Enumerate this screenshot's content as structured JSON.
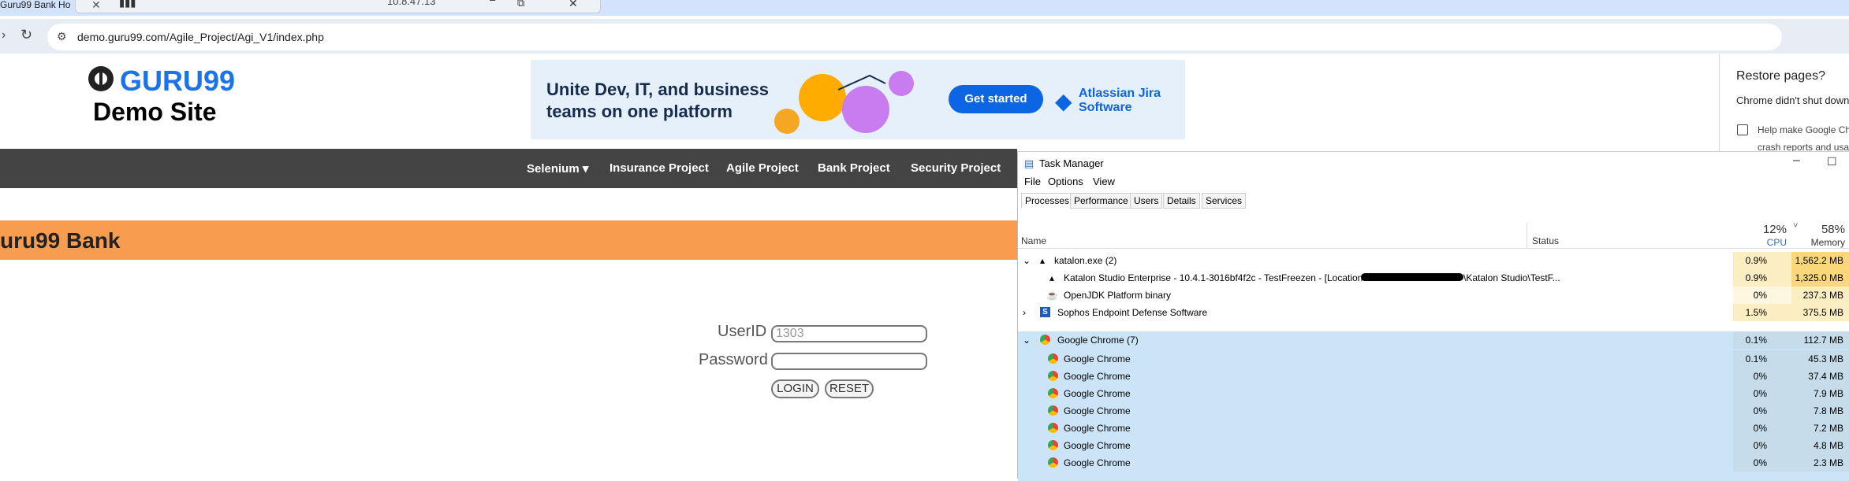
{
  "browser": {
    "tab_title": "Guru99 Bank Ho",
    "remote_ip": "10.8.47.13",
    "url": "demo.guru99.com/Agile_Project/Agi_V1/index.php"
  },
  "site": {
    "brand": "GURU99",
    "subtitle": "Demo Site"
  },
  "ad": {
    "headline": "Unite Dev, IT, and business teams on one platform",
    "cta": "Get started",
    "product": "Atlassian Jira Software"
  },
  "nav": {
    "items": [
      "Selenium ▾",
      "Insurance Project",
      "Agile Project",
      "Bank Project",
      "Security Project"
    ]
  },
  "banner": {
    "title": "uru99 Bank"
  },
  "login": {
    "userid_label": "UserID",
    "userid_value": "1303",
    "password_label": "Password",
    "login_btn": "LOGIN",
    "reset_btn": "RESET"
  },
  "restore": {
    "title": "Restore pages?",
    "body": "Chrome didn't shut down",
    "checkbox": "Help make Google Ch",
    "footer": "crash reports and usag"
  },
  "task_manager": {
    "title": "Task Manager",
    "menu": [
      "File",
      "Options",
      "View"
    ],
    "tabs": [
      "Processes",
      "Performance",
      "Users",
      "Details",
      "Services"
    ],
    "cpu_total": "12%",
    "mem_total": "58%",
    "col_name": "Name",
    "col_status": "Status",
    "col_cpu": "CPU",
    "col_memory": "Memory",
    "rows": [
      {
        "name": "katalon.exe (2)",
        "cpu": "0.9%",
        "mem": "1,562.2 MB"
      },
      {
        "name": "Katalon Studio Enterprise - 10.4.1-3016bf4f2c - TestFreezen - [Location:",
        "name_tail": "\\Katalon Studio\\TestF...",
        "cpu": "0.9%",
        "mem": "1,325.0 MB"
      },
      {
        "name": "OpenJDK Platform binary",
        "cpu": "0%",
        "mem": "237.3 MB"
      },
      {
        "name": "Sophos Endpoint Defense Software",
        "cpu": "1.5%",
        "mem": "375.5 MB"
      },
      {
        "name": "Google Chrome (7)",
        "cpu": "0.1%",
        "mem": "112.7 MB"
      },
      {
        "name": "Google Chrome",
        "cpu": "0.1%",
        "mem": "45.3 MB"
      },
      {
        "name": "Google Chrome",
        "cpu": "0%",
        "mem": "37.4 MB"
      },
      {
        "name": "Google Chrome",
        "cpu": "0%",
        "mem": "7.9 MB"
      },
      {
        "name": "Google Chrome",
        "cpu": "0%",
        "mem": "7.8 MB"
      },
      {
        "name": "Google Chrome",
        "cpu": "0%",
        "mem": "7.2 MB"
      },
      {
        "name": "Google Chrome",
        "cpu": "0%",
        "mem": "4.8 MB"
      },
      {
        "name": "Google Chrome",
        "cpu": "0%",
        "mem": "2.3 MB"
      }
    ]
  },
  "colors": {
    "nav_bg": "#444444",
    "banner_bg": "#f89c50",
    "chrome_row": "#cce4f7",
    "mem_high": "#f9d77a"
  }
}
